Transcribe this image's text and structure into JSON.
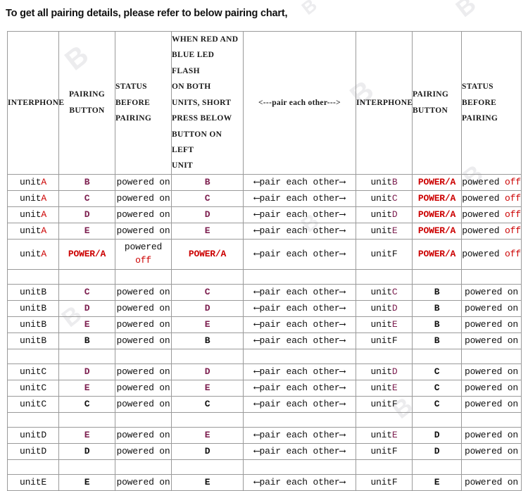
{
  "title": "To get all pairing details, please refer to below pairing chart,",
  "colors": {
    "red": "#cc0000",
    "purple": "#7d2050",
    "black": "#111111",
    "border": "#9a9a9a"
  },
  "table": {
    "headers": {
      "interphone_left": "INTERPHONE",
      "pairing_button_left_line1": "PAIRING",
      "pairing_button_left_line2": "BUTTON",
      "status_before_pairing_line1": "STATUS",
      "status_before_pairing_line2": "BEFORE",
      "status_before_pairing_line3": "PAIRING",
      "instruction_line1": "WHEN RED AND",
      "instruction_line2": "BLUE LED FLASH",
      "instruction_line3": "ON BOTH",
      "instruction_line4": "UNITS, SHORT",
      "instruction_line5": "PRESS BELOW",
      "instruction_line6": "BUTTON ON LEFT",
      "instruction_line7": "UNIT",
      "pair_each_other": "<---pair  each other--->",
      "interphone_right": "INTERPHONE",
      "pairing_button_right_line1": "PAIRING",
      "pairing_button_right_line2": "BUTTON",
      "status_before_pairing_right_line1": "STATUS",
      "status_before_pairing_right_line2": "BEFORE PAIRING"
    },
    "arrow_cell": "⟵pair each other⟶",
    "blocks": [
      {
        "id": "unitA-block",
        "rows": [
          {
            "left_unit_base": "unit",
            "left_unit_letter": "A",
            "left_unit_letter_color": "red",
            "left_button": "B",
            "left_button_color": "purple",
            "left_status": "powered on",
            "left_status_suffix": "",
            "left_status_suffix_color": "black",
            "press_button": "B",
            "press_button_color": "purple",
            "arrow": "⟵pair each other⟶",
            "right_unit_base": "unit",
            "right_unit_letter": "B",
            "right_unit_letter_color": "purple",
            "right_button": "POWER/A",
            "right_button_color": "red",
            "right_status": "powered ",
            "right_status_suffix": "off",
            "right_status_suffix_color": "red",
            "tall": false
          },
          {
            "left_unit_base": "unit",
            "left_unit_letter": "A",
            "left_unit_letter_color": "red",
            "left_button": "C",
            "left_button_color": "purple",
            "left_status": "powered on",
            "left_status_suffix": "",
            "left_status_suffix_color": "black",
            "press_button": "C",
            "press_button_color": "purple",
            "arrow": "⟵pair each other⟶",
            "right_unit_base": "unit",
            "right_unit_letter": "C",
            "right_unit_letter_color": "purple",
            "right_button": "POWER/A",
            "right_button_color": "red",
            "right_status": "powered ",
            "right_status_suffix": "off",
            "right_status_suffix_color": "red",
            "tall": false
          },
          {
            "left_unit_base": "unit",
            "left_unit_letter": "A",
            "left_unit_letter_color": "red",
            "left_button": "D",
            "left_button_color": "purple",
            "left_status": "powered on",
            "left_status_suffix": "",
            "left_status_suffix_color": "black",
            "press_button": "D",
            "press_button_color": "purple",
            "arrow": "⟵pair each other⟶",
            "right_unit_base": "unit",
            "right_unit_letter": "D",
            "right_unit_letter_color": "purple",
            "right_button": "POWER/A",
            "right_button_color": "red",
            "right_status": "powered ",
            "right_status_suffix": "off",
            "right_status_suffix_color": "red",
            "tall": false
          },
          {
            "left_unit_base": "unit",
            "left_unit_letter": "A",
            "left_unit_letter_color": "red",
            "left_button": "E",
            "left_button_color": "purple",
            "left_status": "powered on",
            "left_status_suffix": "",
            "left_status_suffix_color": "black",
            "press_button": "E",
            "press_button_color": "purple",
            "arrow": "⟵pair each other⟶",
            "right_unit_base": "unit",
            "right_unit_letter": "E",
            "right_unit_letter_color": "purple",
            "right_button": "POWER/A",
            "right_button_color": "red",
            "right_status": "powered ",
            "right_status_suffix": "off",
            "right_status_suffix_color": "red",
            "tall": false
          },
          {
            "left_unit_base": "unit",
            "left_unit_letter": "A",
            "left_unit_letter_color": "red",
            "left_button": "POWER/A",
            "left_button_color": "red",
            "left_status": "powered",
            "left_status_suffix": "off",
            "left_status_suffix_color": "red",
            "left_status_twoline": true,
            "press_button": "POWER/A",
            "press_button_color": "red",
            "arrow": "⟵pair each other⟶",
            "right_unit_base": "unit",
            "right_unit_letter": "F",
            "right_unit_letter_color": "black",
            "right_button": "POWER/A",
            "right_button_color": "red",
            "right_status": "powered ",
            "right_status_suffix": "off",
            "right_status_suffix_color": "red",
            "tall": true
          }
        ]
      },
      {
        "id": "unitB-block",
        "rows": [
          {
            "left_unit_base": "unit",
            "left_unit_letter": "B",
            "left_unit_letter_color": "black",
            "left_button": "C",
            "left_button_color": "purple",
            "left_status": "powered on",
            "left_status_suffix": "",
            "left_status_suffix_color": "black",
            "press_button": "C",
            "press_button_color": "purple",
            "arrow": "⟵pair each other⟶",
            "right_unit_base": "unit",
            "right_unit_letter": "C",
            "right_unit_letter_color": "purple",
            "right_button": "B",
            "right_button_color": "black",
            "right_status": "powered on",
            "right_status_suffix": "",
            "right_status_suffix_color": "black",
            "tall": false
          },
          {
            "left_unit_base": "unit",
            "left_unit_letter": "B",
            "left_unit_letter_color": "black",
            "left_button": "D",
            "left_button_color": "purple",
            "left_status": "powered on",
            "left_status_suffix": "",
            "left_status_suffix_color": "black",
            "press_button": "D",
            "press_button_color": "purple",
            "arrow": "⟵pair each other⟶",
            "right_unit_base": "unit",
            "right_unit_letter": "D",
            "right_unit_letter_color": "purple",
            "right_button": "B",
            "right_button_color": "black",
            "right_status": "powered on",
            "right_status_suffix": "",
            "right_status_suffix_color": "black",
            "tall": false
          },
          {
            "left_unit_base": "unit",
            "left_unit_letter": "B",
            "left_unit_letter_color": "black",
            "left_button": "E",
            "left_button_color": "purple",
            "left_status": "powered on",
            "left_status_suffix": "",
            "left_status_suffix_color": "black",
            "press_button": "E",
            "press_button_color": "purple",
            "arrow": "⟵pair each other⟶",
            "right_unit_base": "unit",
            "right_unit_letter": "E",
            "right_unit_letter_color": "purple",
            "right_button": "B",
            "right_button_color": "black",
            "right_status": "powered on",
            "right_status_suffix": "",
            "right_status_suffix_color": "black",
            "tall": false
          },
          {
            "left_unit_base": "unit",
            "left_unit_letter": "B",
            "left_unit_letter_color": "black",
            "left_button": "B",
            "left_button_color": "black",
            "left_status": "powered on",
            "left_status_suffix": "",
            "left_status_suffix_color": "black",
            "press_button": "B",
            "press_button_color": "black",
            "arrow": "⟵pair each other⟶",
            "right_unit_base": "unit",
            "right_unit_letter": "F",
            "right_unit_letter_color": "black",
            "right_button": "B",
            "right_button_color": "black",
            "right_status": "powered on",
            "right_status_suffix": "",
            "right_status_suffix_color": "black",
            "tall": false
          }
        ]
      },
      {
        "id": "unitC-block",
        "rows": [
          {
            "left_unit_base": "unit",
            "left_unit_letter": "C",
            "left_unit_letter_color": "black",
            "left_button": "D",
            "left_button_color": "purple",
            "left_status": "powered on",
            "left_status_suffix": "",
            "left_status_suffix_color": "black",
            "press_button": "D",
            "press_button_color": "purple",
            "arrow": "⟵pair each other⟶",
            "right_unit_base": "unit",
            "right_unit_letter": "D",
            "right_unit_letter_color": "purple",
            "right_button": "C",
            "right_button_color": "black",
            "right_status": "powered on",
            "right_status_suffix": "",
            "right_status_suffix_color": "black",
            "tall": false
          },
          {
            "left_unit_base": "unit",
            "left_unit_letter": "C",
            "left_unit_letter_color": "black",
            "left_button": "E",
            "left_button_color": "purple",
            "left_status": "powered on",
            "left_status_suffix": "",
            "left_status_suffix_color": "black",
            "press_button": "E",
            "press_button_color": "purple",
            "arrow": "⟵pair each other⟶",
            "right_unit_base": "unit",
            "right_unit_letter": "E",
            "right_unit_letter_color": "purple",
            "right_button": "C",
            "right_button_color": "black",
            "right_status": "powered on",
            "right_status_suffix": "",
            "right_status_suffix_color": "black",
            "tall": false
          },
          {
            "left_unit_base": "unit",
            "left_unit_letter": "C",
            "left_unit_letter_color": "black",
            "left_button": "C",
            "left_button_color": "black",
            "left_status": "powered on",
            "left_status_suffix": "",
            "left_status_suffix_color": "black",
            "press_button": "C",
            "press_button_color": "black",
            "arrow": "⟵pair each other⟶",
            "right_unit_base": "unit",
            "right_unit_letter": "F",
            "right_unit_letter_color": "black",
            "right_button": "C",
            "right_button_color": "black",
            "right_status": "powered on",
            "right_status_suffix": "",
            "right_status_suffix_color": "black",
            "tall": false
          }
        ]
      },
      {
        "id": "unitD-block",
        "rows": [
          {
            "left_unit_base": "unit",
            "left_unit_letter": "D",
            "left_unit_letter_color": "black",
            "left_button": "E",
            "left_button_color": "purple",
            "left_status": "powered on",
            "left_status_suffix": "",
            "left_status_suffix_color": "black",
            "press_button": "E",
            "press_button_color": "purple",
            "arrow": "⟵pair each other⟶",
            "right_unit_base": "unit",
            "right_unit_letter": "E",
            "right_unit_letter_color": "purple",
            "right_button": "D",
            "right_button_color": "black",
            "right_status": "powered on",
            "right_status_suffix": "",
            "right_status_suffix_color": "black",
            "tall": false
          },
          {
            "left_unit_base": "unit",
            "left_unit_letter": "D",
            "left_unit_letter_color": "black",
            "left_button": "D",
            "left_button_color": "black",
            "left_status": "powered on",
            "left_status_suffix": "",
            "left_status_suffix_color": "black",
            "press_button": "D",
            "press_button_color": "black",
            "arrow": "⟵pair each other⟶",
            "right_unit_base": "unit",
            "right_unit_letter": "F",
            "right_unit_letter_color": "black",
            "right_button": "D",
            "right_button_color": "black",
            "right_status": "powered on",
            "right_status_suffix": "",
            "right_status_suffix_color": "black",
            "tall": false
          }
        ]
      },
      {
        "id": "unitE-block",
        "rows": [
          {
            "left_unit_base": "unit",
            "left_unit_letter": "E",
            "left_unit_letter_color": "black",
            "left_button": "E",
            "left_button_color": "black",
            "left_status": "powered on",
            "left_status_suffix": "",
            "left_status_suffix_color": "black",
            "press_button": "E",
            "press_button_color": "black",
            "arrow": "⟵pair each other⟶",
            "right_unit_base": "unit",
            "right_unit_letter": "F",
            "right_unit_letter_color": "black",
            "right_button": "E",
            "right_button_color": "black",
            "right_status": "powered on",
            "right_status_suffix": "",
            "right_status_suffix_color": "black",
            "tall": false
          }
        ]
      }
    ]
  }
}
